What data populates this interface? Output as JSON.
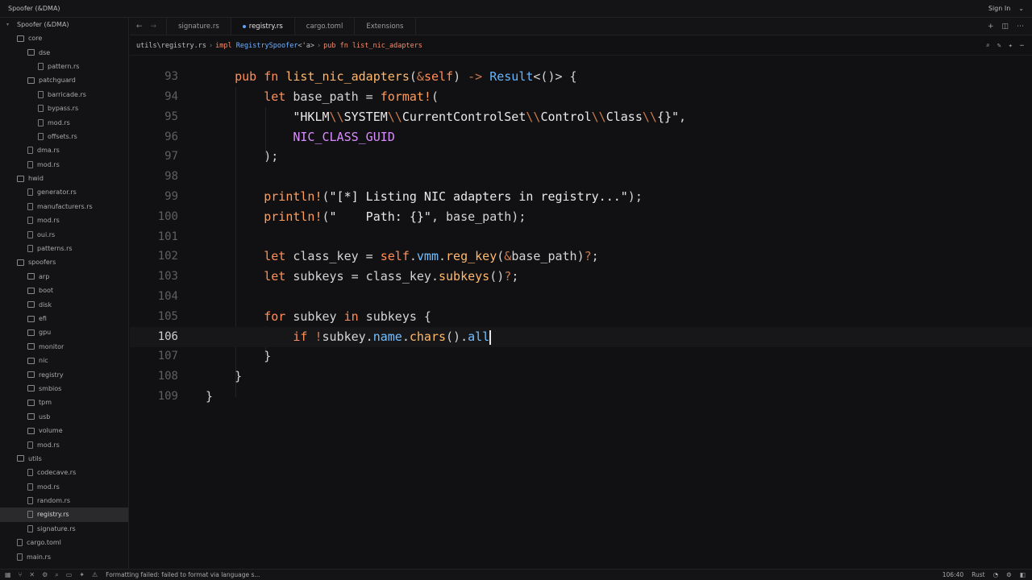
{
  "window": {
    "title": "Spoofer (&DMA)",
    "sign_in": "Sign In"
  },
  "sidebar": {
    "root": "Spoofer (&DMA)",
    "tree": [
      {
        "label": "core",
        "kind": "folder",
        "depth": 1
      },
      {
        "label": "dse",
        "kind": "folder",
        "depth": 2
      },
      {
        "label": "pattern.rs",
        "kind": "file",
        "depth": 3
      },
      {
        "label": "patchguard",
        "kind": "folder",
        "depth": 2
      },
      {
        "label": "barricade.rs",
        "kind": "file",
        "depth": 3
      },
      {
        "label": "bypass.rs",
        "kind": "file",
        "depth": 3
      },
      {
        "label": "mod.rs",
        "kind": "file",
        "depth": 3
      },
      {
        "label": "offsets.rs",
        "kind": "file",
        "depth": 3
      },
      {
        "label": "dma.rs",
        "kind": "file",
        "depth": 2
      },
      {
        "label": "mod.rs",
        "kind": "file",
        "depth": 2
      },
      {
        "label": "hwid",
        "kind": "folder",
        "depth": 1
      },
      {
        "label": "generator.rs",
        "kind": "file",
        "depth": 2
      },
      {
        "label": "manufacturers.rs",
        "kind": "file",
        "depth": 2
      },
      {
        "label": "mod.rs",
        "kind": "file",
        "depth": 2
      },
      {
        "label": "oui.rs",
        "kind": "file",
        "depth": 2
      },
      {
        "label": "patterns.rs",
        "kind": "file",
        "depth": 2
      },
      {
        "label": "spoofers",
        "kind": "folder",
        "depth": 1
      },
      {
        "label": "arp",
        "kind": "folder",
        "depth": 2
      },
      {
        "label": "boot",
        "kind": "folder",
        "depth": 2
      },
      {
        "label": "disk",
        "kind": "folder",
        "depth": 2
      },
      {
        "label": "efi",
        "kind": "folder",
        "depth": 2
      },
      {
        "label": "gpu",
        "kind": "folder",
        "depth": 2
      },
      {
        "label": "monitor",
        "kind": "folder",
        "depth": 2
      },
      {
        "label": "nic",
        "kind": "folder",
        "depth": 2
      },
      {
        "label": "registry",
        "kind": "folder",
        "depth": 2
      },
      {
        "label": "smbios",
        "kind": "folder",
        "depth": 2
      },
      {
        "label": "tpm",
        "kind": "folder",
        "depth": 2
      },
      {
        "label": "usb",
        "kind": "folder",
        "depth": 2
      },
      {
        "label": "volume",
        "kind": "folder",
        "depth": 2
      },
      {
        "label": "mod.rs",
        "kind": "file",
        "depth": 2
      },
      {
        "label": "utils",
        "kind": "folder",
        "depth": 1
      },
      {
        "label": "codecave.rs",
        "kind": "file",
        "depth": 2
      },
      {
        "label": "mod.rs",
        "kind": "file",
        "depth": 2
      },
      {
        "label": "random.rs",
        "kind": "file",
        "depth": 2
      },
      {
        "label": "registry.rs",
        "kind": "file",
        "depth": 2,
        "active": true
      },
      {
        "label": "signature.rs",
        "kind": "file",
        "depth": 2
      },
      {
        "label": "cargo.toml",
        "kind": "file",
        "depth": 1
      },
      {
        "label": "main.rs",
        "kind": "file",
        "depth": 1
      }
    ]
  },
  "tabs": [
    {
      "label": "signature.rs",
      "active": false
    },
    {
      "label": "registry.rs",
      "active": true
    },
    {
      "label": "cargo.toml",
      "active": false
    },
    {
      "label": "Extensions",
      "active": false
    }
  ],
  "breadcrumb": {
    "path": "utils\\registry.rs",
    "impl_kw": "impl",
    "impl_type": "RegistrySpoofer",
    "impl_lifetime": "<'a>",
    "fn_sig": "pub fn list_nic_adapters"
  },
  "editor": {
    "current_line": "106",
    "lines": [
      {
        "n": "93"
      },
      {
        "n": "94"
      },
      {
        "n": "95"
      },
      {
        "n": "96"
      },
      {
        "n": "97"
      },
      {
        "n": "98"
      },
      {
        "n": "99"
      },
      {
        "n": "100"
      },
      {
        "n": "101"
      },
      {
        "n": "102"
      },
      {
        "n": "103"
      },
      {
        "n": "104"
      },
      {
        "n": "105"
      },
      {
        "n": "106"
      },
      {
        "n": "107"
      },
      {
        "n": "108"
      },
      {
        "n": "109"
      }
    ]
  },
  "status": {
    "message": "Formatting failed: failed to format via language s...",
    "cursor_pos": "106:40",
    "language": "Rust"
  },
  "colors": {
    "accent": "#58a6ff",
    "background": "#111113"
  }
}
